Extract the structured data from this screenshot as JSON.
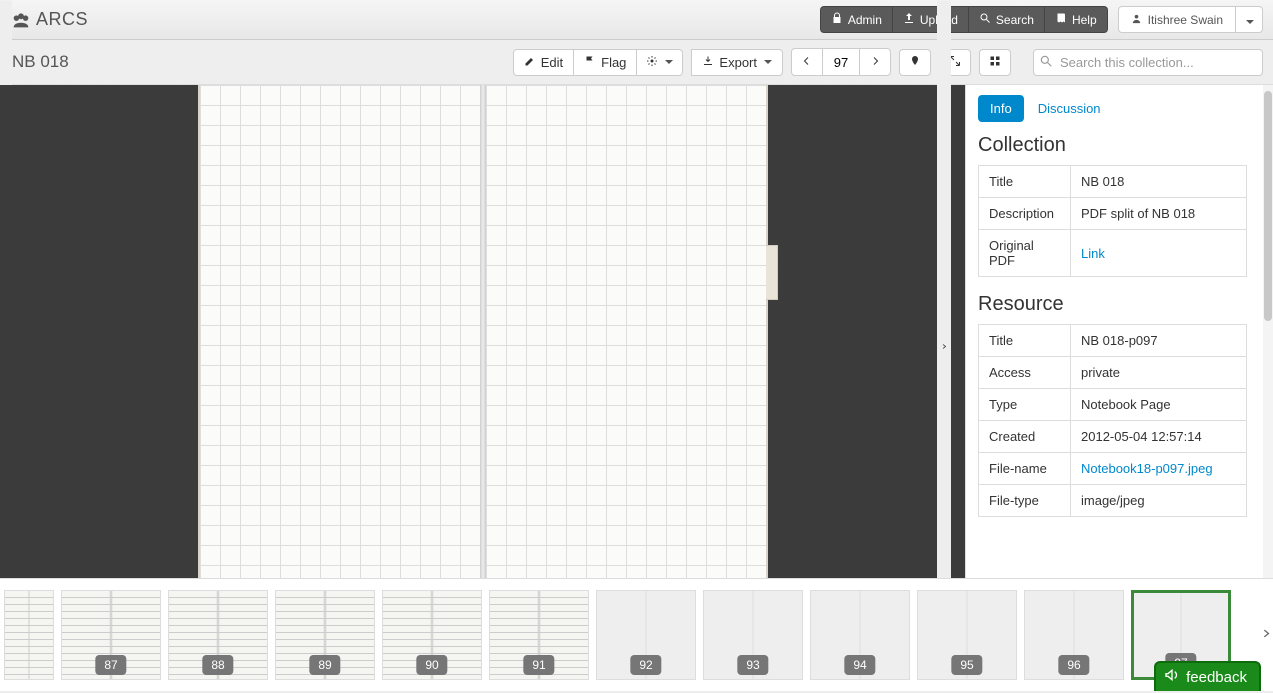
{
  "app": {
    "name": "ARCS"
  },
  "header": {
    "admin": "Admin",
    "upload": "Upload",
    "search": "Search",
    "help": "Help",
    "user": "Itishree Swain"
  },
  "toolbar": {
    "collection_title": "NB 018",
    "edit": "Edit",
    "flag": "Flag",
    "export": "Export",
    "page_number": "97",
    "search_placeholder": "Search this collection..."
  },
  "sidebar": {
    "tabs": {
      "info": "Info",
      "discussion": "Discussion"
    },
    "collection": {
      "heading": "Collection",
      "rows": [
        {
          "label": "Title",
          "value": "NB 018"
        },
        {
          "label": "Description",
          "value": "PDF split of NB 018"
        },
        {
          "label": "Original PDF",
          "value": "Link",
          "is_link": true
        }
      ]
    },
    "resource": {
      "heading": "Resource",
      "rows": [
        {
          "label": "Title",
          "value": "NB 018-p097"
        },
        {
          "label": "Access",
          "value": "private"
        },
        {
          "label": "Type",
          "value": "Notebook Page"
        },
        {
          "label": "Created",
          "value": "2012-05-04 12:57:14"
        },
        {
          "label": "File-name",
          "value": "Notebook18-p097.jpeg",
          "is_link": true
        },
        {
          "label": "File-type",
          "value": "image/jpeg"
        }
      ]
    }
  },
  "thumbnails": [
    {
      "page": "87",
      "kind": "text"
    },
    {
      "page": "88",
      "kind": "text"
    },
    {
      "page": "89",
      "kind": "text"
    },
    {
      "page": "90",
      "kind": "text"
    },
    {
      "page": "91",
      "kind": "text"
    },
    {
      "page": "92",
      "kind": "blank"
    },
    {
      "page": "93",
      "kind": "blank"
    },
    {
      "page": "94",
      "kind": "blank"
    },
    {
      "page": "95",
      "kind": "blank"
    },
    {
      "page": "96",
      "kind": "blank"
    },
    {
      "page": "97",
      "kind": "blank",
      "current": true
    }
  ],
  "feedback": {
    "label": "feedback"
  }
}
